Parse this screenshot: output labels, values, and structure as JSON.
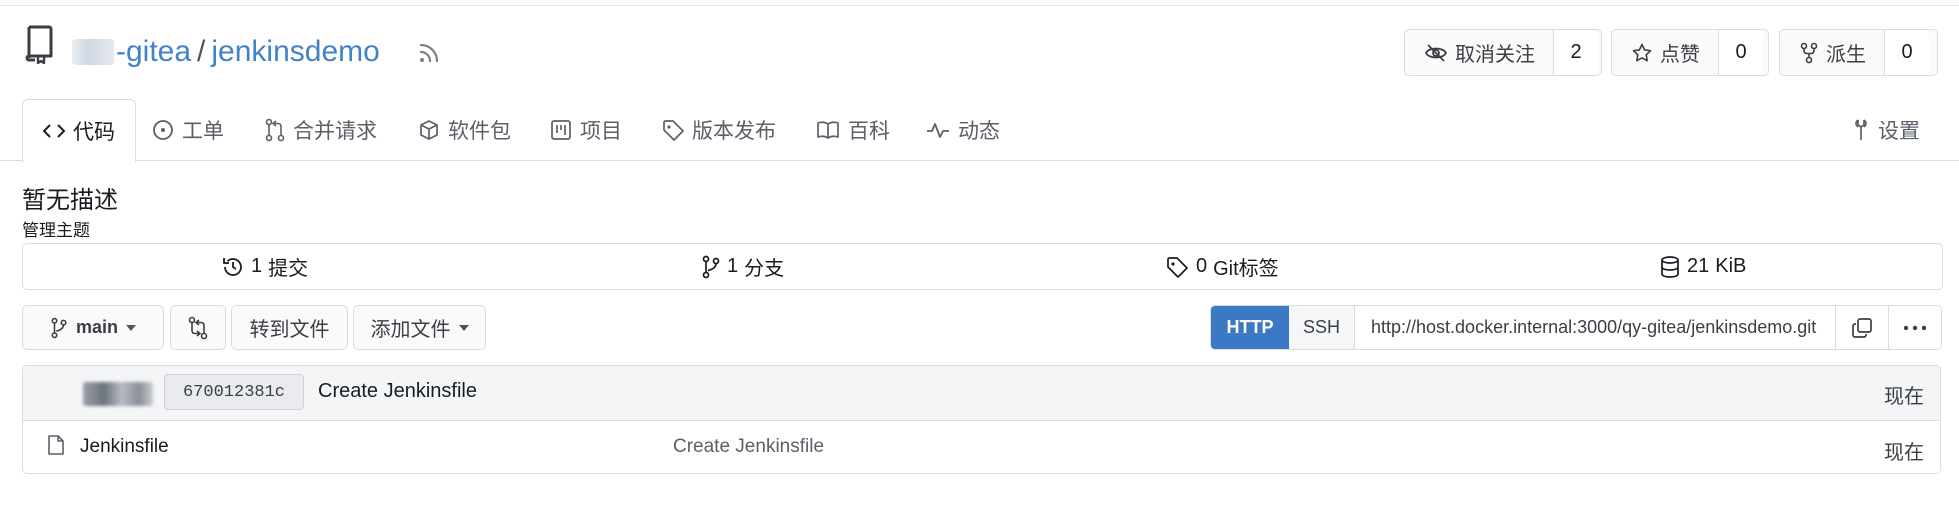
{
  "repo": {
    "owner": "-gitea",
    "separator": "/",
    "name": "jenkinsdemo"
  },
  "actions": {
    "watch": {
      "label": "取消关注",
      "count": "2"
    },
    "star": {
      "label": "点赞",
      "count": "0"
    },
    "fork": {
      "label": "派生",
      "count": "0"
    }
  },
  "tabs": [
    {
      "label": "代码",
      "icon": "code-icon"
    },
    {
      "label": "工单",
      "icon": "issue-icon"
    },
    {
      "label": "合并请求",
      "icon": "pull-request-icon"
    },
    {
      "label": "软件包",
      "icon": "package-icon"
    },
    {
      "label": "项目",
      "icon": "project-icon"
    },
    {
      "label": "版本发布",
      "icon": "tag-icon"
    },
    {
      "label": "百科",
      "icon": "book-icon"
    },
    {
      "label": "动态",
      "icon": "pulse-icon"
    },
    {
      "label": "设置",
      "icon": "tools-icon"
    }
  ],
  "description": "暂无描述",
  "topics_link": "管理主题",
  "stats": {
    "commits": {
      "value": "1",
      "label": "提交"
    },
    "branches": {
      "value": "1",
      "label": "分支"
    },
    "tags": {
      "value": "0",
      "label": "Git标签"
    },
    "size": {
      "value": "21",
      "label": "KiB"
    }
  },
  "toolbar": {
    "branch": "main",
    "go_to_file": "转到文件",
    "add_file": "添加文件"
  },
  "clone": {
    "http": "HTTP",
    "ssh": "SSH",
    "url": "http://host.docker.internal:3000/qy-gitea/jenkinsdemo.git"
  },
  "latest_commit": {
    "sha": "670012381c",
    "message": "Create Jenkinsfile",
    "time": "现在"
  },
  "files": [
    {
      "name": "Jenkinsfile",
      "commit": "Create Jenkinsfile",
      "time": "现在"
    }
  ],
  "colors": {
    "accent": "#4183c4",
    "http_active": "#3b79c4",
    "border": "#d9dce0"
  }
}
